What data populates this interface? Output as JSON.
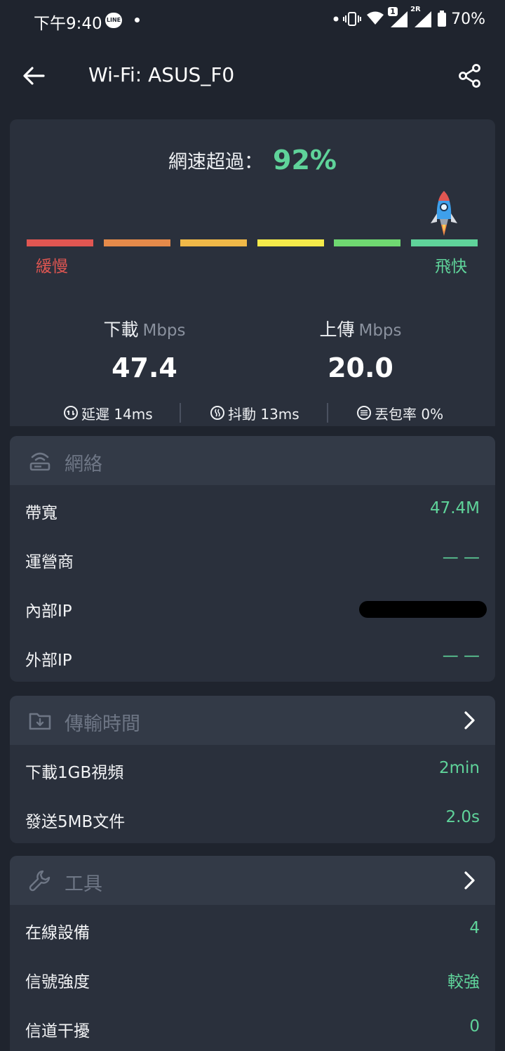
{
  "status_bar": {
    "time": "下午9:40",
    "line_badge": "LINE",
    "sim1_badge": "1",
    "sim2_badge": "2R",
    "battery": "70%"
  },
  "app_bar": {
    "title": "Wi-Fi: ASUS_F0",
    "back_icon": "arrow-left-icon",
    "share_icon": "share-icon"
  },
  "speed_summary": {
    "exceed_label": "網速超過：",
    "exceed_value": "92%",
    "slow_label": "緩慢",
    "fast_label": "飛快",
    "scale_colors": [
      "#e05652",
      "#e58a4a",
      "#f0b848",
      "#f5ea4a",
      "#6fd871",
      "#5fd39a"
    ],
    "level_fraction": 0.92,
    "download_label": "下載",
    "upload_label": "上傳",
    "unit": "Mbps",
    "download_value": "47.4",
    "upload_value": "20.0",
    "latency": "延遲 14ms",
    "jitter": "抖動 13ms",
    "packet_loss": "丟包率 0%"
  },
  "network": {
    "title": "網絡",
    "rows": [
      {
        "label": "帶寬",
        "value": "47.4M"
      },
      {
        "label": "運營商",
        "value": "— —"
      },
      {
        "label": "內部IP",
        "value": ""
      },
      {
        "label": "外部IP",
        "value": "— —"
      }
    ]
  },
  "transfer": {
    "title": "傳輸時間",
    "rows": [
      {
        "label": "下載1GB視頻",
        "value": "2min"
      },
      {
        "label": "發送5MB文件",
        "value": "2.0s"
      }
    ]
  },
  "tools": {
    "title": "工具",
    "rows": [
      {
        "label": "在線設備",
        "value": "4"
      },
      {
        "label": "信號強度",
        "value": "較強"
      },
      {
        "label": "信道干擾",
        "value": "0"
      }
    ]
  },
  "colors": {
    "background": "#1f242e",
    "card": "#2a303c",
    "accent": "#5fd39a",
    "slow": "#e05652"
  }
}
